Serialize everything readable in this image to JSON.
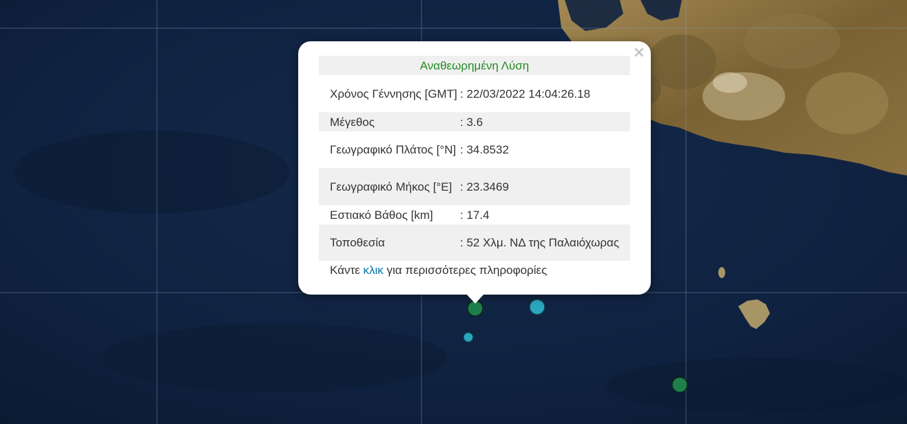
{
  "popup": {
    "title": "Αναθεωρημένη Λύση",
    "close_symbol": "×",
    "rows": [
      {
        "label": "Χρόνος Γέννησης [GMT]",
        "value": ": 22/03/2022 14:04:26.18"
      },
      {
        "label": "Μέγεθος",
        "value": ": 3.6"
      },
      {
        "label": "Γεωγραφικό Πλάτος [°N]",
        "value": ": 34.8532"
      },
      {
        "label": "Γεωγραφικό Μήκος [°E]",
        "value": ": 23.3469"
      },
      {
        "label": "Εστιακό Βάθος [km]",
        "value": ": 17.4"
      },
      {
        "label": "Τοποθεσία",
        "value": ": 52 Χλμ. ΝΔ της Παλαιόχωρας"
      }
    ],
    "footer": {
      "prefix": "Κάντε",
      "link": "κλικ",
      "suffix": "για περισσότερες πληροφορίες"
    }
  },
  "markers": [
    {
      "name": "quake-marker-selected",
      "color": "#1f7f4a"
    },
    {
      "name": "quake-marker-large",
      "color": "#2aa7bd"
    },
    {
      "name": "quake-marker-small",
      "color": "#2aa7bd"
    },
    {
      "name": "quake-marker-east",
      "color": "#1f7f4a"
    }
  ],
  "colors": {
    "sea": "#0c1d35",
    "land": "#8a6d3b",
    "title": "#228B22",
    "link": "#0078a8"
  }
}
